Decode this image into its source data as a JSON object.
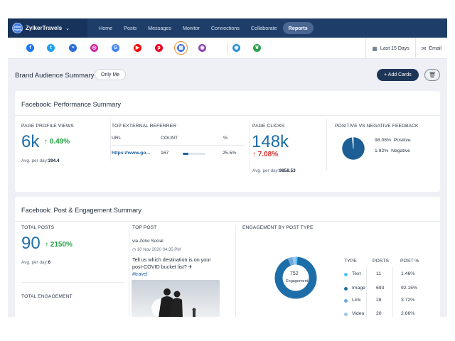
{
  "brand": {
    "name": "ZylkerTravels",
    "logo_text": "Zylker Travels",
    "caret": "⌄"
  },
  "nav": [
    {
      "label": "Home"
    },
    {
      "label": "Posts"
    },
    {
      "label": "Messages"
    },
    {
      "label": "Monitor"
    },
    {
      "label": "Connections"
    },
    {
      "label": "Collaborate"
    },
    {
      "label": "Reports",
      "active": true
    }
  ],
  "networks": [
    {
      "icon": "facebook-icon",
      "glyph": "f",
      "color": "#1877f2"
    },
    {
      "icon": "twitter-icon",
      "glyph": "t",
      "color": "#1da1f2"
    },
    {
      "icon": "document-icon",
      "glyph": "≡",
      "color": "#2a6bd6"
    },
    {
      "icon": "instagram-icon",
      "glyph": "◎",
      "color": "#d6249f"
    },
    {
      "icon": "google-icon",
      "glyph": "G",
      "color": "#4285f4"
    },
    {
      "icon": "youtube-icon",
      "glyph": "▶",
      "color": "#ff0000"
    },
    {
      "icon": "pinterest-icon",
      "glyph": "p",
      "color": "#e60023"
    },
    {
      "icon": "dashboard-icon",
      "glyph": "▦",
      "color": "#3a6fd8",
      "selected": true
    },
    {
      "icon": "zoho-icon",
      "glyph": "◉",
      "color": "#8e44ad"
    },
    {
      "icon": "eye-icon",
      "glyph": "◉",
      "color": "#2a8fd6"
    },
    {
      "icon": "leaf-icon",
      "glyph": "❦",
      "color": "#2e9e4f"
    }
  ],
  "date_range": {
    "label": "Last 15 Days",
    "icon": "calendar-icon"
  },
  "email": {
    "label": "Email",
    "icon": "mail-icon"
  },
  "page": {
    "title": "Brand Audience Summary",
    "visibility": "Only Me",
    "add_cards": "+ Add Cards",
    "trash_icon": "trash-icon"
  },
  "performance": {
    "title": "Facebook: Performance Summary",
    "profile_views": {
      "label": "PAGE PROFILE VIEWS",
      "value": "6k",
      "change": "↑ 0.49%",
      "avg_label": "Avg. per day:",
      "avg_value": "394.4"
    },
    "referrer": {
      "label": "TOP EXTERNAL REFERRER",
      "headers": [
        "URL",
        "COUNT",
        "%"
      ],
      "rows": [
        {
          "url": "https://www.go...",
          "count": "167",
          "percent": "25.5%",
          "fraction": 0.255
        }
      ]
    },
    "page_clicks": {
      "label": "PAGE CLICKS",
      "value": "148k",
      "change": "↑ 7.08%",
      "avg_label": "Avg. per day:",
      "avg_value": "9858.53"
    },
    "feedback": {
      "label": "POSITIVE VS NEGATIVE FEEDBACK",
      "items": [
        {
          "percent": "98.08%",
          "name": "Positive",
          "value": 98.08
        },
        {
          "percent": "1.92%",
          "name": "Negative",
          "value": 1.92
        }
      ]
    }
  },
  "engagement": {
    "title": "Facebook: Post & Engagement Summary",
    "total_posts": {
      "label": "TOTAL POSTS",
      "value": "90",
      "change": "↑ 2150%",
      "avg_label": "Avg. per day:",
      "avg_value": "6"
    },
    "total_engagement": {
      "label": "TOTAL ENGAGEMENT"
    },
    "top_post": {
      "label": "TOP POST",
      "via": "via Zoho Social",
      "date": "10 Nov 2020 04:35 PM",
      "text": "Tell us which destination is on your post-COVID bucket list? ✈",
      "tag": "#travel"
    },
    "by_type": {
      "label": "ENGAGEMENT BY POST TYPE",
      "center_value": "752",
      "center_label": "Engagement",
      "headers": [
        "TYPE",
        "POSTS",
        "POST %"
      ],
      "rows": [
        {
          "type": "Text",
          "posts": "11",
          "percent": "1.46%",
          "value": 1.46,
          "color": "#4fc3f7"
        },
        {
          "type": "Image",
          "posts": "693",
          "percent": "92.15%",
          "value": 92.15,
          "color": "#1d6ea8"
        },
        {
          "type": "Link",
          "posts": "28",
          "percent": "3.72%",
          "value": 3.72,
          "color": "#6fa8dc"
        },
        {
          "type": "Video",
          "posts": "20",
          "percent": "2.66%",
          "value": 2.66,
          "color": "#9fc5e8"
        }
      ]
    }
  },
  "colors": {
    "nav_bg": "#17335c",
    "accent": "#1d6ea8",
    "positive": "#1e9e3c",
    "negative": "#d32f2f"
  }
}
